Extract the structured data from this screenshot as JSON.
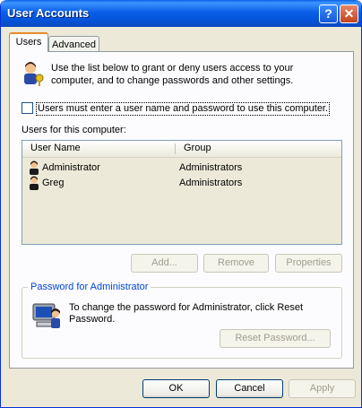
{
  "window": {
    "title": "User Accounts",
    "help_button": "?",
    "close_button": "✕"
  },
  "tabs": [
    {
      "label": "Users",
      "selected": true
    },
    {
      "label": "Advanced",
      "selected": false
    }
  ],
  "intro": {
    "icon": "users-keys-icon",
    "text": "Use the list below to grant or deny users access to your computer, and to change passwords and other settings."
  },
  "require_login": {
    "checked": false,
    "label": "Users must enter a user name and password to use this computer."
  },
  "users_list": {
    "label": "Users for this computer:",
    "columns": [
      "User Name",
      "Group"
    ],
    "rows": [
      {
        "icon": "user-icon",
        "user_name": "Administrator",
        "group": "Administrators"
      },
      {
        "icon": "user-icon",
        "user_name": "Greg",
        "group": "Administrators"
      }
    ]
  },
  "list_buttons": {
    "add": "Add...",
    "remove": "Remove",
    "properties": "Properties"
  },
  "password_group": {
    "title": "Password for Administrator",
    "icon": "computer-user-icon",
    "text": "To change the password for Administrator, click Reset Password.",
    "reset_button": "Reset Password..."
  },
  "dialog_buttons": {
    "ok": "OK",
    "cancel": "Cancel",
    "apply": "Apply"
  },
  "colors": {
    "title_bar": "#0a5ee8",
    "window_face": "#ece9d8",
    "tab_highlight": "#e68b2c",
    "group_title": "#0046d5"
  }
}
